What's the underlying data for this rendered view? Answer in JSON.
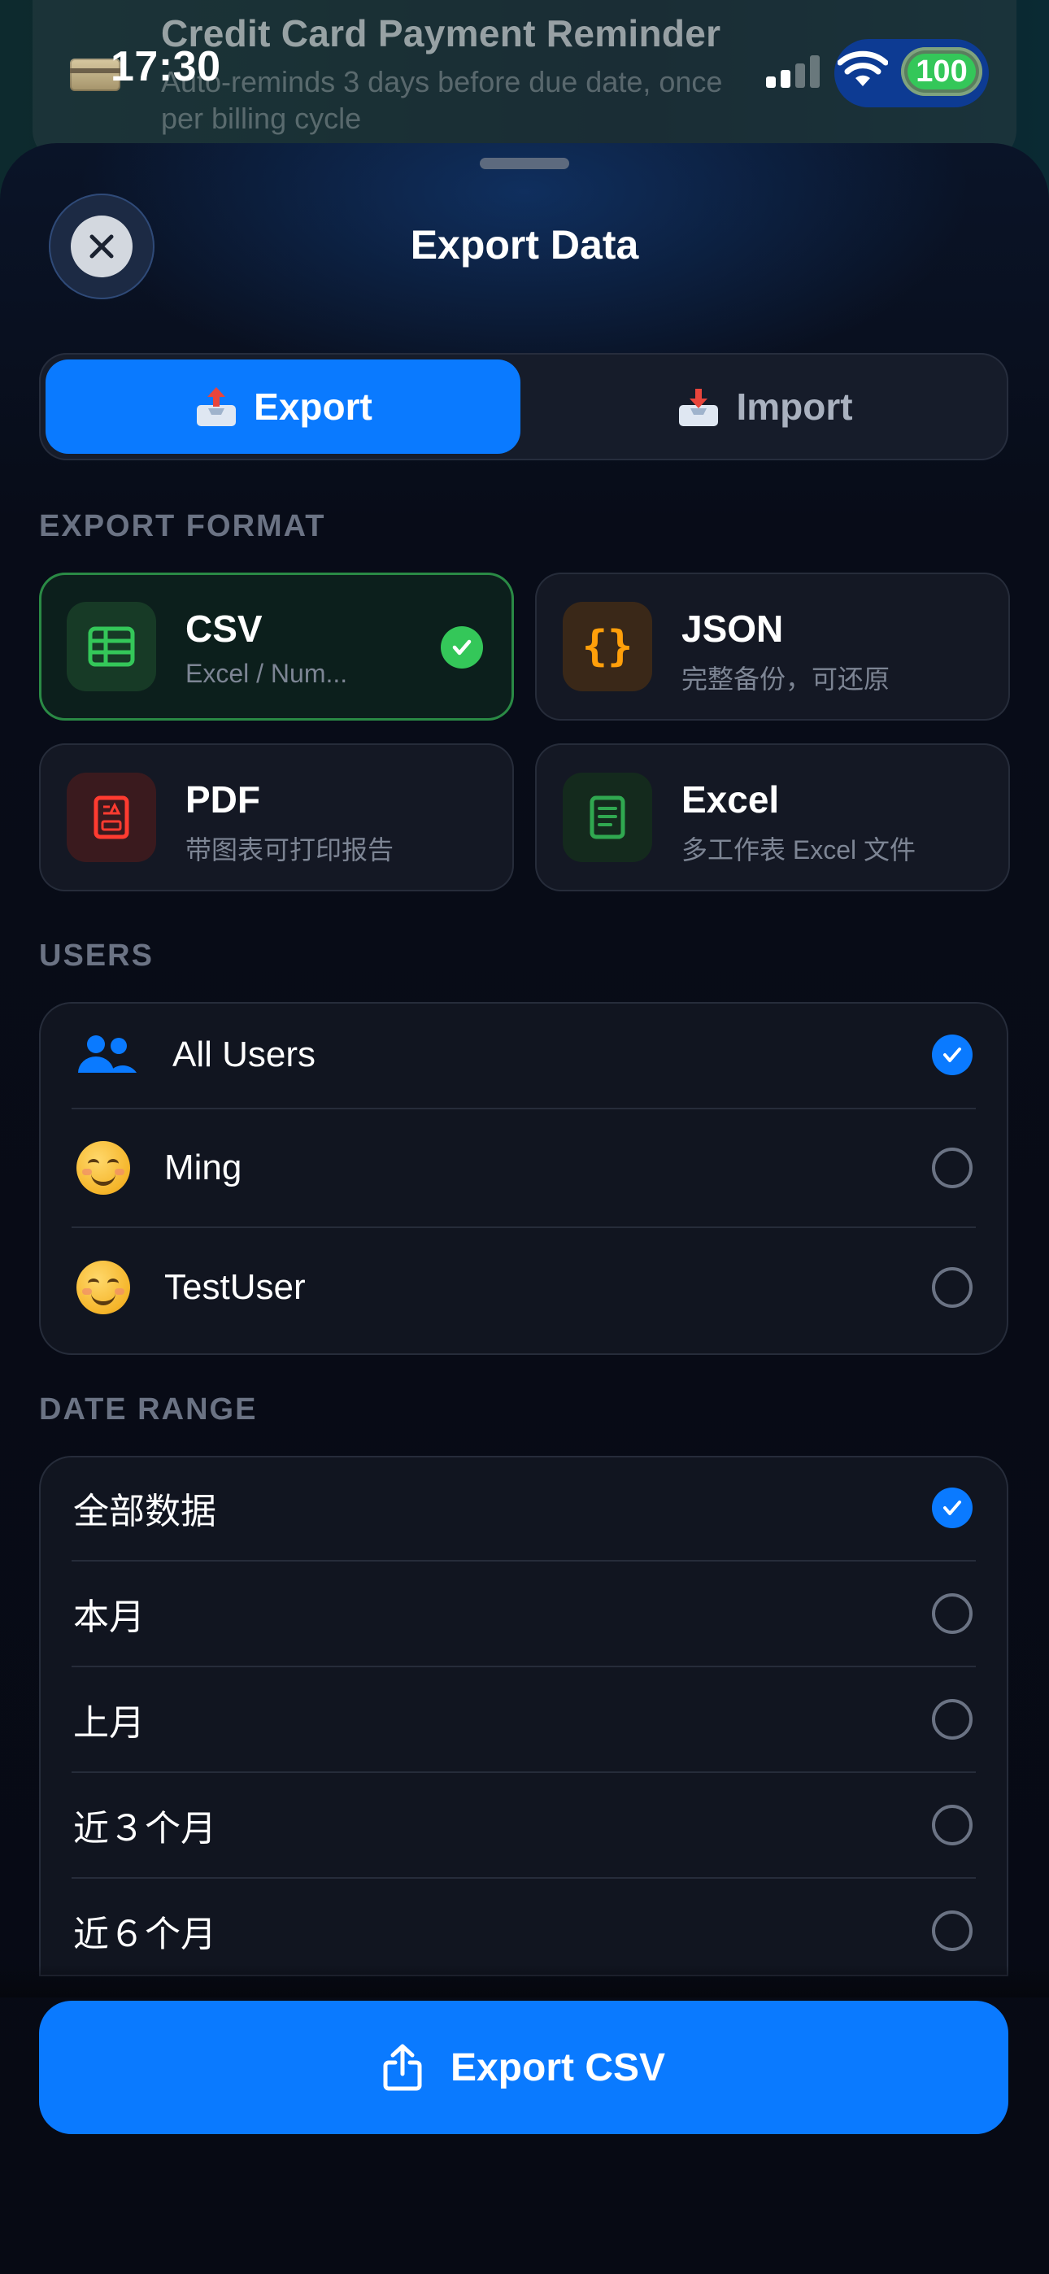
{
  "background_notification": {
    "title": "Credit Card Payment Reminder",
    "subtitle": "Auto-reminds 3 days before due date, once per billing cycle"
  },
  "status_bar": {
    "time": "17:30",
    "battery": "100"
  },
  "sheet": {
    "title": "Export Data",
    "tabs": [
      {
        "label": "Export",
        "active": true
      },
      {
        "label": "Import",
        "active": false
      }
    ],
    "export_format": {
      "label": "EXPORT FORMAT",
      "options": [
        {
          "title": "CSV",
          "subtitle": "Excel / Num...",
          "selected": true,
          "icon": "table-icon",
          "color": "#34c759"
        },
        {
          "title": "JSON",
          "subtitle": "完整备份，可还原",
          "selected": false,
          "icon": "braces-icon",
          "color": "#ff9f0a"
        },
        {
          "title": "PDF",
          "subtitle": "带图表可打印报告",
          "selected": false,
          "icon": "pdf-document-icon",
          "color": "#ff3b30"
        },
        {
          "title": "Excel",
          "subtitle": "多工作表 Excel 文件",
          "selected": false,
          "icon": "spreadsheet-document-icon",
          "color": "#30a850"
        }
      ]
    },
    "users": {
      "label": "USERS",
      "items": [
        {
          "label": "All Users",
          "selected": true,
          "icon": "people-icon"
        },
        {
          "label": "Ming",
          "selected": false,
          "icon": "smiling-face-emoji"
        },
        {
          "label": "TestUser",
          "selected": false,
          "icon": "smiling-face-emoji"
        }
      ]
    },
    "date_range": {
      "label": "DATE RANGE",
      "items": [
        {
          "label": "全部数据",
          "selected": true
        },
        {
          "label": "本月",
          "selected": false
        },
        {
          "label": "上月",
          "selected": false
        },
        {
          "label": "近３个月",
          "selected": false
        },
        {
          "label": "近６个月",
          "selected": false
        }
      ]
    },
    "export_button": {
      "label": "Export CSV",
      "icon": "share-icon"
    }
  },
  "colors": {
    "accent": "#0a7aff",
    "success": "#34c759",
    "background": "#05070d"
  }
}
